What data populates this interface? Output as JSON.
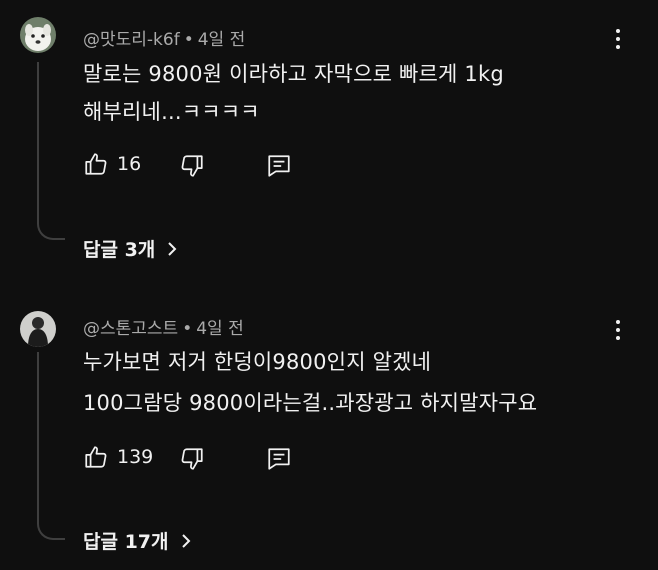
{
  "comments": [
    {
      "author": "@맛도리-k6f",
      "separator": "•",
      "time": "4일 전",
      "lines": [
        "말로는 9800원 이라하고 자막으로 빠르게 1kg",
        "해부리네...ㅋㅋㅋㅋ"
      ],
      "likes": "16",
      "replies_label": "답글 3개",
      "avatar_icon": "dog-avatar-icon"
    },
    {
      "author": "@스톤고스트",
      "separator": "•",
      "time": "4일 전",
      "lines": [
        "누가보면 저거 한덩이9800인지 알겠네",
        "100그람당 9800이라는걸..과장광고 하지말자구요"
      ],
      "likes": "139",
      "replies_label": "답글 17개",
      "avatar_icon": "person-avatar-icon"
    }
  ],
  "icons": {
    "like": "thumbs-up-icon",
    "dislike": "thumbs-down-icon",
    "reply": "reply-icon",
    "menu": "more-vert-icon",
    "chevron": "chevron-right-icon"
  },
  "colors": {
    "background": "#0f0f0f",
    "text": "#f1f1f1",
    "meta": "#aaaaaa",
    "thread_line": "#3f3f3f"
  }
}
